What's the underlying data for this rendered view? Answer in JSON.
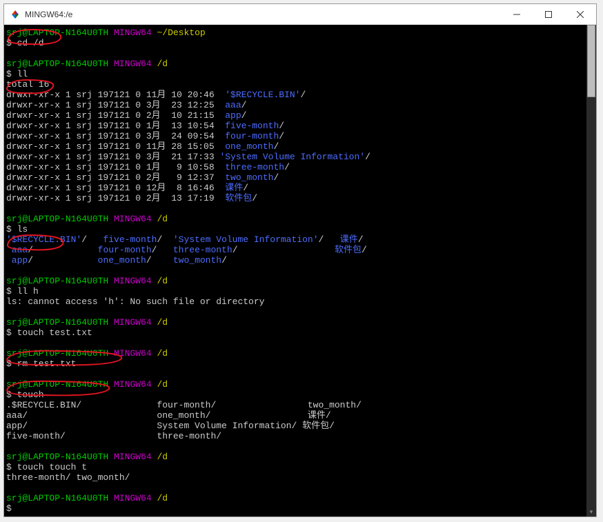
{
  "window": {
    "title": "MINGW64:/e"
  },
  "prompts": {
    "p1_user": "srj@LAPTOP-N164U0TH",
    "p1_shell": "MINGW64",
    "p1_path": "~/Desktop",
    "cmd1": "cd /d",
    "p2_path": "/d",
    "cmd2": "ll",
    "total": "total 16",
    "cmd3": "ls",
    "cmd4": "ll h",
    "err4": "ls: cannot access 'h': No such file or directory",
    "cmd5": "touch test.txt",
    "cmd6": "rm test.txt",
    "cmd7": "touch",
    "cmd8": "touch touch t",
    "tabcomp8": "three-month/ two_month/",
    "dollar": "$"
  },
  "ll_rows": [
    {
      "perm": "drwxr-xr-x 1 srj 197121 0 11月 10 20:46  ",
      "name": "'$RECYCLE.BIN'",
      "trail": "/"
    },
    {
      "perm": "drwxr-xr-x 1 srj 197121 0 3月  23 12:25  ",
      "name": "aaa",
      "trail": "/"
    },
    {
      "perm": "drwxr-xr-x 1 srj 197121 0 2月  10 21:15  ",
      "name": "app",
      "trail": "/"
    },
    {
      "perm": "drwxr-xr-x 1 srj 197121 0 1月  13 10:54  ",
      "name": "five-month",
      "trail": "/"
    },
    {
      "perm": "drwxr-xr-x 1 srj 197121 0 3月  24 09:54  ",
      "name": "four-month",
      "trail": "/"
    },
    {
      "perm": "drwxr-xr-x 1 srj 197121 0 11月 28 15:05  ",
      "name": "one_month",
      "trail": "/"
    },
    {
      "perm": "drwxr-xr-x 1 srj 197121 0 3月  21 17:33 ",
      "name": "'System Volume Information'",
      "trail": "/"
    },
    {
      "perm": "drwxr-xr-x 1 srj 197121 0 1月   9 10:58  ",
      "name": "three-month",
      "trail": "/"
    },
    {
      "perm": "drwxr-xr-x 1 srj 197121 0 2月   9 12:37  ",
      "name": "two_month",
      "trail": "/"
    },
    {
      "perm": "drwxr-xr-x 1 srj 197121 0 12月  8 16:46  ",
      "name": "课件",
      "trail": "/"
    },
    {
      "perm": "drwxr-xr-x 1 srj 197121 0 2月  13 17:19  ",
      "name": "软件包",
      "trail": "/"
    }
  ],
  "ls_cols": {
    "r1c1": "'$RECYCLE.BIN'",
    "r1c1t": "/   ",
    "r1c2": "five-month",
    "r1c2t": "/  ",
    "r1c3": "'System Volume Information'",
    "r1c3t": "/   ",
    "r1c4": "课件",
    "r1c4t": "/",
    "r2c1": " aaa",
    "r2c1t": "/            ",
    "r2c2": "four-month",
    "r2c2t": "/   ",
    "r2c3": "three-month",
    "r2c3t": "/                  ",
    "r2c4": "软件包",
    "r2c4t": "/",
    "r3c1": " app",
    "r3c1t": "/            ",
    "r3c2": "one_month",
    "r3c2t": "/    ",
    "r3c3": "two_month",
    "r3c3t": "/"
  },
  "touch_tab": {
    "r1": ".$RECYCLE.BIN/              four-month/                 two_month/",
    "r2": "aaa/                        one_month/                  课件/",
    "r3": "app/                        System Volume Information/ 软件包/",
    "r4": "five-month/                 three-month/"
  }
}
